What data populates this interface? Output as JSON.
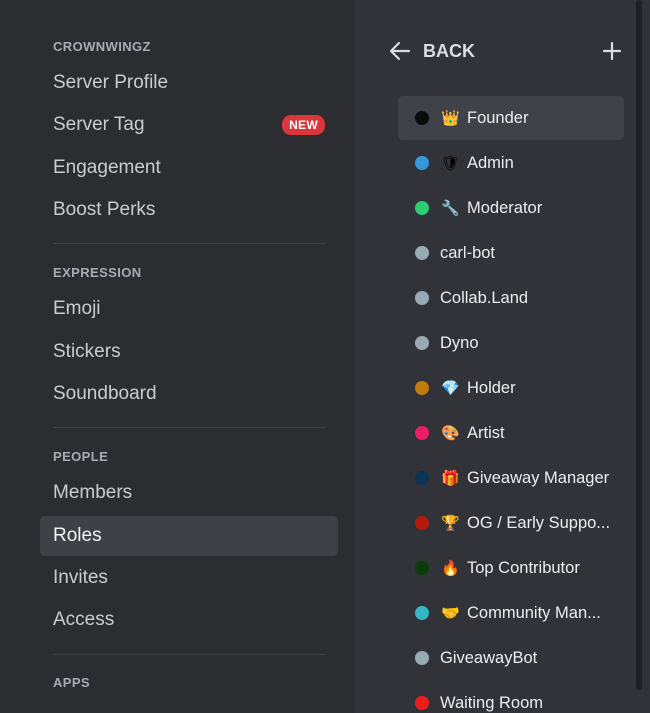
{
  "sidebar": {
    "server_header": "CROWNWINGZ",
    "server_items": [
      {
        "label": "Server Profile"
      },
      {
        "label": "Server Tag",
        "badge": "NEW"
      },
      {
        "label": "Engagement"
      },
      {
        "label": "Boost Perks"
      }
    ],
    "expression_header": "EXPRESSION",
    "expression_items": [
      {
        "label": "Emoji"
      },
      {
        "label": "Stickers"
      },
      {
        "label": "Soundboard"
      }
    ],
    "people_header": "PEOPLE",
    "people_items": [
      {
        "label": "Members"
      },
      {
        "label": "Roles",
        "active": true
      },
      {
        "label": "Invites"
      },
      {
        "label": "Access"
      }
    ],
    "apps_header": "APPS"
  },
  "roles_panel": {
    "back_label": "BACK",
    "add_icon": "plus-icon",
    "roles": [
      {
        "name": "Founder",
        "emoji": "👑",
        "color": "#0b0b0b",
        "active": true
      },
      {
        "name": "Admin",
        "emoji": "🛡",
        "color": "#3498db"
      },
      {
        "name": "Moderator",
        "emoji": "🔧",
        "color": "#2ecc71"
      },
      {
        "name": "carl-bot",
        "emoji": "",
        "color": "#99aab5"
      },
      {
        "name": "Collab.Land",
        "emoji": "",
        "color": "#99aab5"
      },
      {
        "name": "Dyno",
        "emoji": "",
        "color": "#99aab5"
      },
      {
        "name": "Holder",
        "emoji": "💎",
        "color": "#c27c0e"
      },
      {
        "name": "Artist",
        "emoji": "🎨",
        "color": "#e91e63"
      },
      {
        "name": "Giveaway Manager",
        "emoji": "🎁",
        "color": "#0a3358"
      },
      {
        "name": "OG / Early Suppo...",
        "emoji": "🏆",
        "color": "#b41a0c"
      },
      {
        "name": "Top Contributor",
        "emoji": "🔥",
        "color": "#0a3d0a"
      },
      {
        "name": "Community Man...",
        "emoji": "🤝",
        "color": "#35b5c5"
      },
      {
        "name": "GiveawayBot",
        "emoji": "",
        "color": "#99aab5"
      },
      {
        "name": "Waiting Room",
        "emoji": "",
        "color": "#ee1c1c"
      }
    ]
  }
}
